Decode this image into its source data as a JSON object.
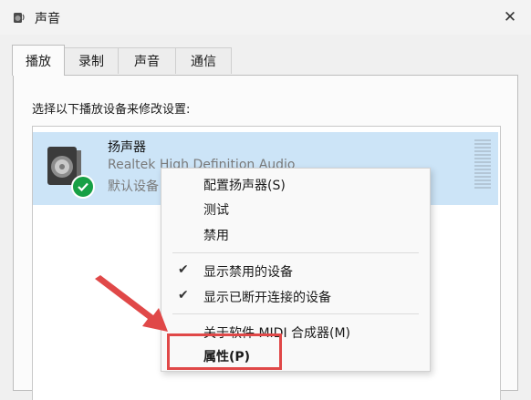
{
  "window": {
    "title": "声音",
    "close_glyph": "✕"
  },
  "tabs": [
    {
      "label": "播放",
      "active": true
    },
    {
      "label": "录制",
      "active": false
    },
    {
      "label": "声音",
      "active": false
    },
    {
      "label": "通信",
      "active": false
    }
  ],
  "panel": {
    "instruction": "选择以下播放设备来修改设置:"
  },
  "device": {
    "name": "扬声器",
    "description": "Realtek High Definition Audio",
    "status": "默认设备",
    "icon": "speaker-icon",
    "badge": "default-check-icon"
  },
  "context_menu": {
    "items": [
      {
        "label": "配置扬声器(S)",
        "checked": false
      },
      {
        "label": "测试",
        "checked": false
      },
      {
        "label": "禁用",
        "checked": false
      },
      {
        "label": "显示禁用的设备",
        "checked": true
      },
      {
        "label": "显示已断开连接的设备",
        "checked": true
      },
      {
        "label": "关于软件 MIDI 合成器(M)",
        "checked": false
      },
      {
        "label": "属性(P)",
        "checked": false
      }
    ],
    "check_glyph": "✔"
  },
  "colors": {
    "selection": "#cce4f7",
    "badge_green": "#17a045",
    "annotation_red": "#e04848"
  }
}
